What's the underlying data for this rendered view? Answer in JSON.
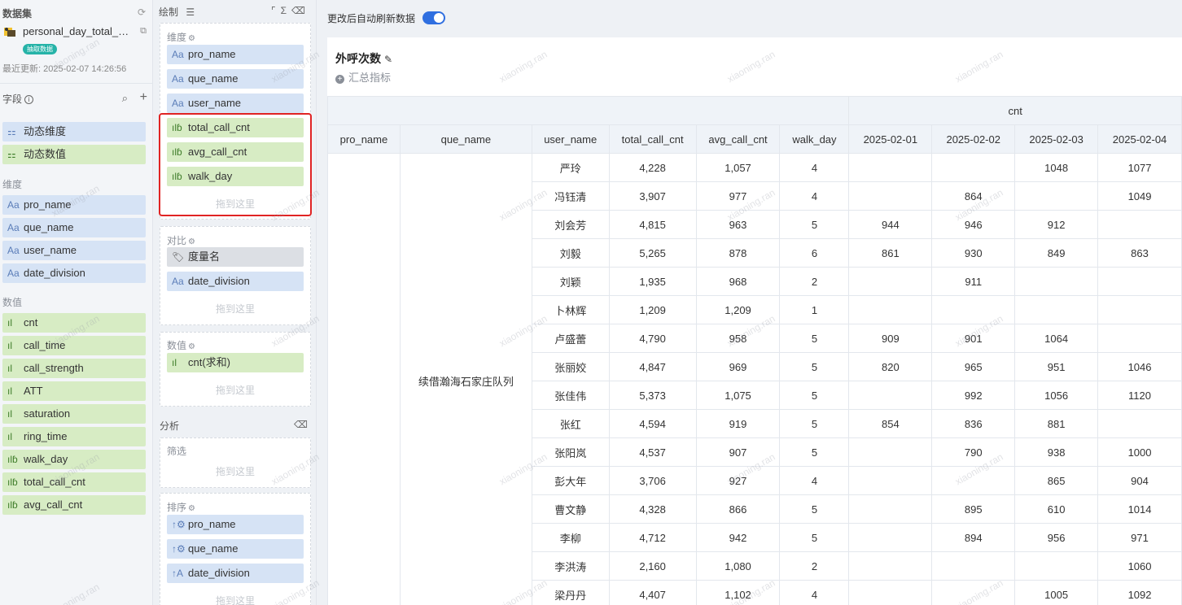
{
  "left": {
    "title": "数据集",
    "dataset_name": "personal_day_total_…",
    "badge": "抽取数据",
    "updated": "最近更新: 2025-02-07 14:26:56",
    "fields_title": "字段",
    "dynamic": [
      {
        "label": "动态维度",
        "icon": "dynamic-icon"
      },
      {
        "label": "动态数值",
        "icon": "dynamic-icon"
      }
    ],
    "dim_label": "维度",
    "dimensions": [
      "pro_name",
      "que_name",
      "user_name",
      "date_division"
    ],
    "mea_label": "数值",
    "measures": [
      "cnt",
      "call_time",
      "call_strength",
      "ATT",
      "saturation",
      "ring_time",
      "walk_day",
      "total_call_cnt",
      "avg_call_cnt"
    ]
  },
  "mid": {
    "title": "绘制",
    "dim_title": "维度",
    "dim_fields": [
      "pro_name",
      "que_name",
      "user_name"
    ],
    "mea_fields": [
      "total_call_cnt",
      "avg_call_cnt",
      "walk_day"
    ],
    "drop_hint": "拖到这里",
    "compare_title": "对比",
    "compare_fields": [
      "度量名",
      "date_division"
    ],
    "value_title": "数值",
    "value_fields": [
      "cnt(求和)"
    ],
    "analysis_title": "分析",
    "filter_title": "筛选",
    "sort_title": "排序",
    "sort_fields": [
      "pro_name",
      "que_name",
      "date_division"
    ]
  },
  "main": {
    "auto_refresh_label": "更改后自动刷新数据",
    "auto_refresh_on": true,
    "card_title": "外呼次数",
    "summary_label": "汇总指标",
    "table": {
      "group_header": "cnt",
      "headers": [
        "pro_name",
        "que_name",
        "user_name",
        "total_call_cnt",
        "avg_call_cnt",
        "walk_day",
        "2025-02-01",
        "2025-02-02",
        "2025-02-03",
        "2025-02-04"
      ],
      "que_name_value": "续借瀚海石家庄队列",
      "rows": [
        [
          "严玲",
          "4,228",
          "1,057",
          "4",
          "",
          "",
          "1048",
          "1077"
        ],
        [
          "冯钰清",
          "3,907",
          "977",
          "4",
          "",
          "864",
          "",
          "1049"
        ],
        [
          "刘会芳",
          "4,815",
          "963",
          "5",
          "944",
          "946",
          "912",
          ""
        ],
        [
          "刘毅",
          "5,265",
          "878",
          "6",
          "861",
          "930",
          "849",
          "863"
        ],
        [
          "刘颖",
          "1,935",
          "968",
          "2",
          "",
          "911",
          "",
          ""
        ],
        [
          "卜林辉",
          "1,209",
          "1,209",
          "1",
          "",
          "",
          "",
          ""
        ],
        [
          "卢盛蕾",
          "4,790",
          "958",
          "5",
          "909",
          "901",
          "1064",
          ""
        ],
        [
          "张丽姣",
          "4,847",
          "969",
          "5",
          "820",
          "965",
          "951",
          "1046"
        ],
        [
          "张佳伟",
          "5,373",
          "1,075",
          "5",
          "",
          "992",
          "1056",
          "1120"
        ],
        [
          "张红",
          "4,594",
          "919",
          "5",
          "854",
          "836",
          "881",
          ""
        ],
        [
          "张阳岚",
          "4,537",
          "907",
          "5",
          "",
          "790",
          "938",
          "1000"
        ],
        [
          "彭大年",
          "3,706",
          "927",
          "4",
          "",
          "",
          "865",
          "904"
        ],
        [
          "曹文静",
          "4,328",
          "866",
          "5",
          "",
          "895",
          "610",
          "1014"
        ],
        [
          "李柳",
          "4,712",
          "942",
          "5",
          "",
          "894",
          "956",
          "971"
        ],
        [
          "李洪涛",
          "2,160",
          "1,080",
          "2",
          "",
          "",
          "",
          "1060"
        ],
        [
          "梁丹丹",
          "4,407",
          "1,102",
          "4",
          "",
          "",
          "1005",
          "1092"
        ]
      ]
    },
    "watermark": "xiaoning.ran"
  }
}
